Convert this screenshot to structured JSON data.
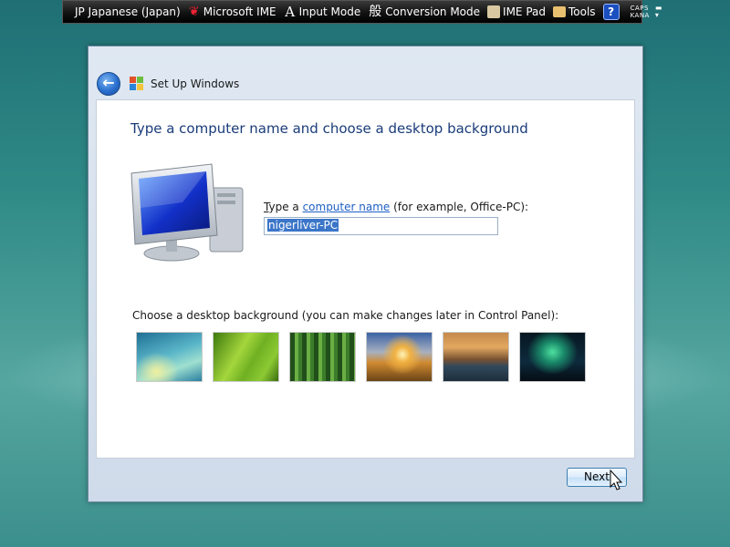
{
  "language_bar": {
    "language": "JP Japanese (Japan)",
    "ime": "Microsoft IME",
    "input_mode": "Input Mode",
    "conversion_glyph": "般",
    "conversion_mode": "Conversion Mode",
    "ime_pad": "IME Pad",
    "tools": "Tools",
    "help": "?",
    "caps": "CAPS",
    "kana": "KANA"
  },
  "window": {
    "title": "Set Up Windows",
    "heading": "Type a computer name and choose a desktop background",
    "name_prompt_prefix_u": "T",
    "name_prompt_prefix": "ype a ",
    "name_prompt_link": "computer name",
    "name_prompt_suffix": " (for example, Office-PC):",
    "computer_name_value": "nigerliver-PC",
    "background_prompt": "Choose a desktop background (you can make changes later in Control Panel):",
    "backgrounds": [
      {
        "name": "aurora-waves",
        "colors": [
          "#1e6f90",
          "#7fd1d6",
          "#e8f0a0"
        ]
      },
      {
        "name": "green-leaf",
        "colors": [
          "#3e7a10",
          "#9ed23a",
          "#6cae22"
        ]
      },
      {
        "name": "bamboo",
        "colors": [
          "#1c4b18",
          "#6fae44",
          "#2f6a22"
        ]
      },
      {
        "name": "sunset-field",
        "colors": [
          "#3a5ea0",
          "#f4c060",
          "#8a5a20"
        ]
      },
      {
        "name": "mountain-lake",
        "colors": [
          "#6b4a2c",
          "#d58a3a",
          "#2a3a4a"
        ]
      },
      {
        "name": "northern-lights",
        "colors": [
          "#06121e",
          "#2ec28a",
          "#0a2a3a"
        ]
      }
    ],
    "next_button": "Next"
  }
}
